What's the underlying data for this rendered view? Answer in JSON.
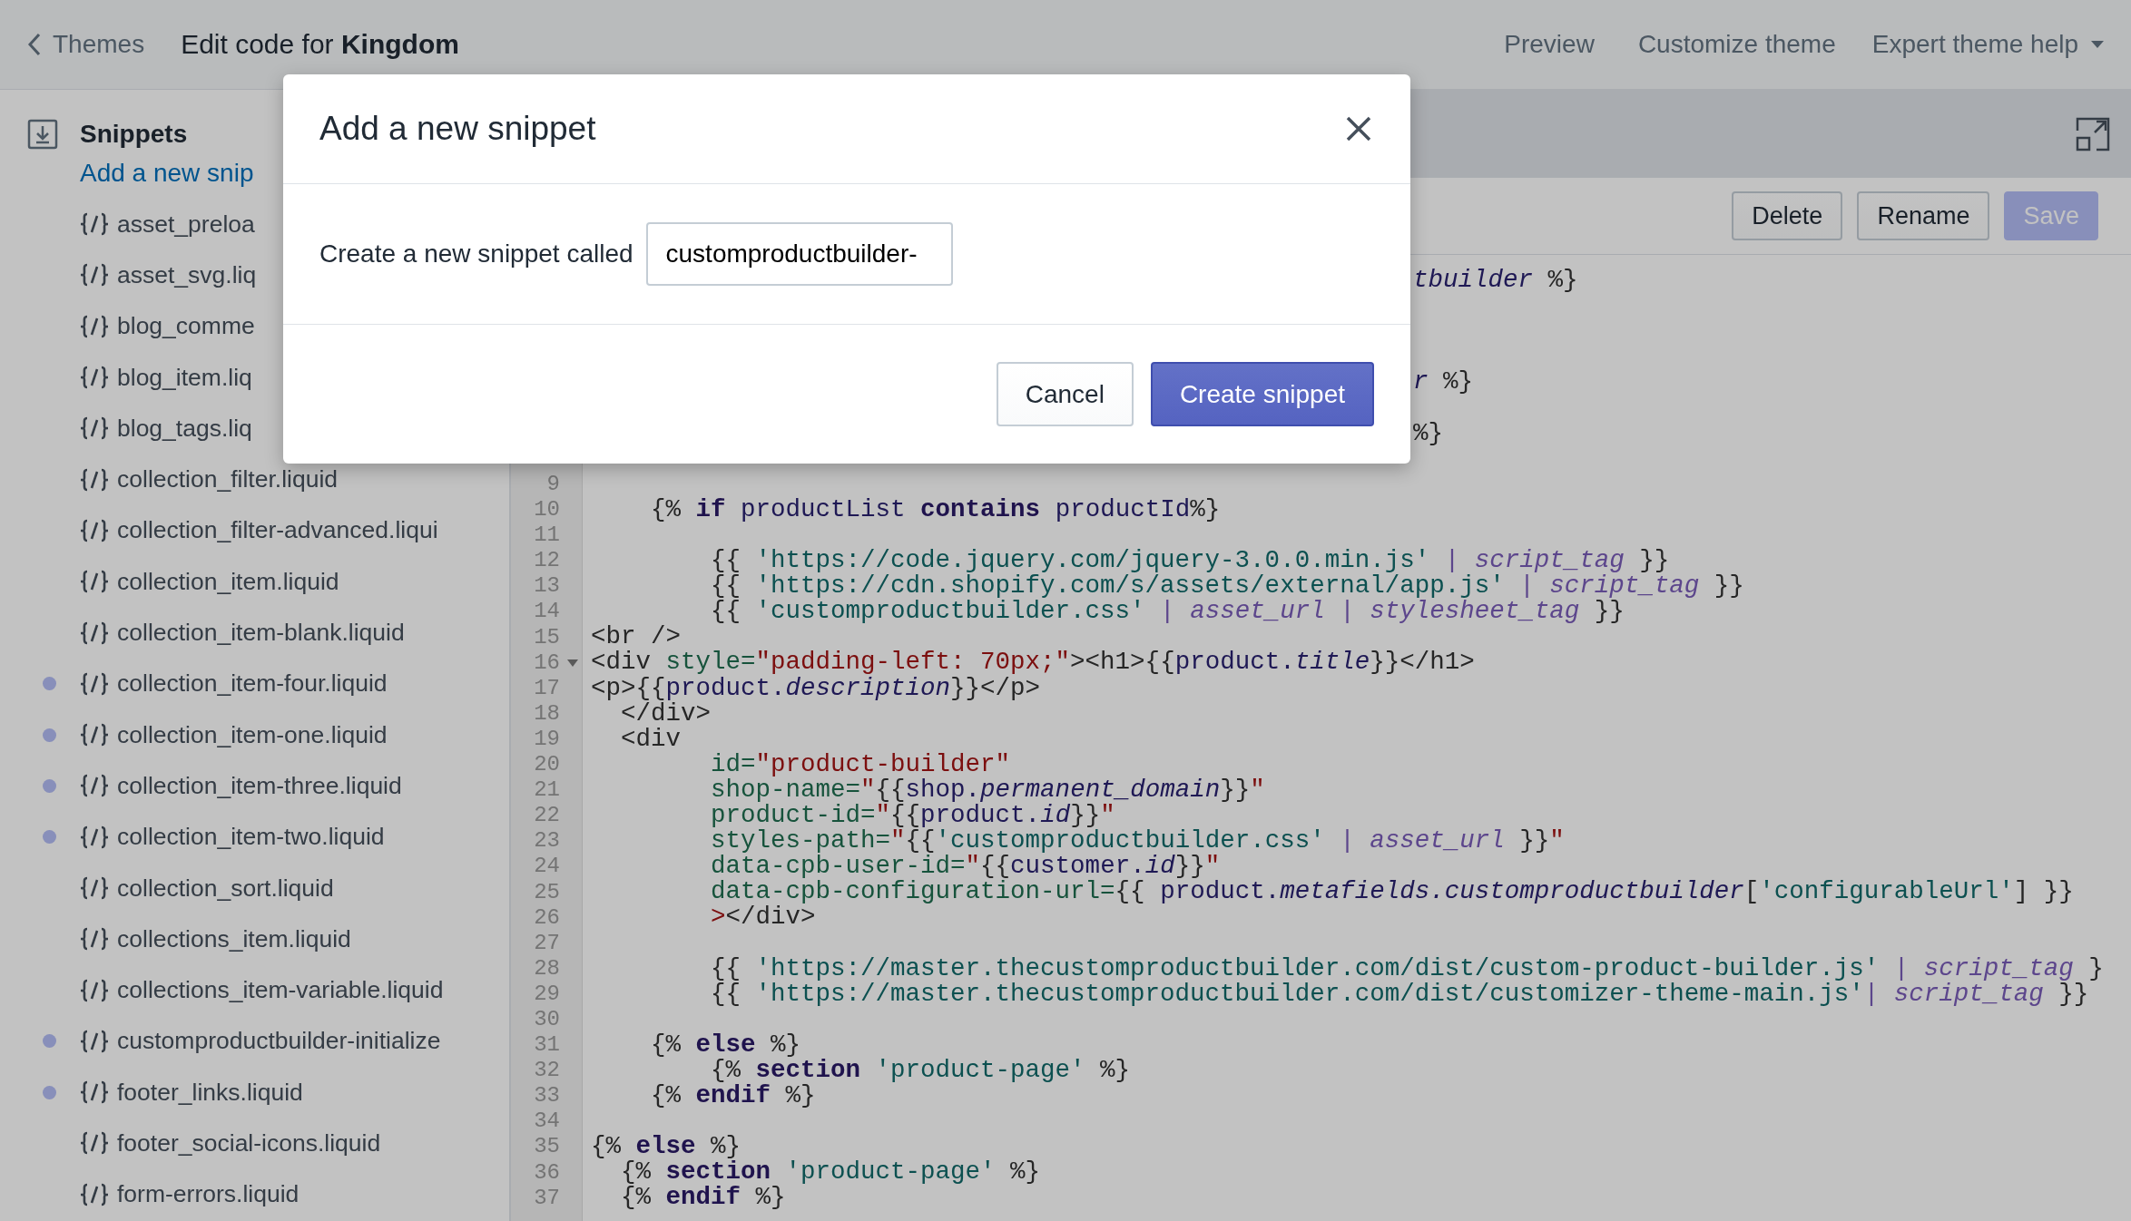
{
  "topbar": {
    "back_link": "Themes",
    "title": "Edit code for **Kingdom**",
    "links": [
      "Preview",
      "Customize theme"
    ],
    "menu": "Expert theme help"
  },
  "sidebar": {
    "heading": "Snippets",
    "add_link": "Add a new snip",
    "items": [
      {
        "name": "asset_preloa",
        "changed": false
      },
      {
        "name": "asset_svg.liq",
        "changed": false
      },
      {
        "name": "blog_comme",
        "changed": false
      },
      {
        "name": "blog_item.liq",
        "changed": false
      },
      {
        "name": "blog_tags.liq",
        "changed": false
      },
      {
        "name": "collection_filter.liquid",
        "changed": false
      },
      {
        "name": "collection_filter-advanced.liqui",
        "changed": false
      },
      {
        "name": "collection_item.liquid",
        "changed": false
      },
      {
        "name": "collection_item-blank.liquid",
        "changed": false
      },
      {
        "name": "collection_item-four.liquid",
        "changed": true
      },
      {
        "name": "collection_item-one.liquid",
        "changed": true
      },
      {
        "name": "collection_item-three.liquid",
        "changed": true
      },
      {
        "name": "collection_item-two.liquid",
        "changed": true
      },
      {
        "name": "collection_sort.liquid",
        "changed": false
      },
      {
        "name": "collections_item.liquid",
        "changed": false
      },
      {
        "name": "collections_item-variable.liquid",
        "changed": false
      },
      {
        "name": "customproductbuilder-initialize",
        "changed": true
      },
      {
        "name": "footer_links.liquid",
        "changed": true
      },
      {
        "name": "footer_social-icons.liquid",
        "changed": false
      },
      {
        "name": "form-errors.liquid",
        "changed": false
      }
    ]
  },
  "toolbar": {
    "buttons": [
      {
        "label": "Delete",
        "disabled": false
      },
      {
        "label": "Rename",
        "disabled": false
      },
      {
        "label": "Save",
        "disabled": true
      }
    ]
  },
  "covered_lines": [
    {
      "tokens": [
        {
          "text": "tbuilder",
          "kind": "i"
        },
        {
          "text": " %}",
          "kind": "p"
        }
      ]
    },
    {
      "tokens": [
        {
          "text": "r",
          "kind": "i"
        },
        {
          "text": " %}",
          "kind": "p"
        }
      ]
    },
    {
      "tokens": [
        {
          "text": "%}",
          "kind": "p"
        }
      ]
    }
  ],
  "lines": [
    {
      "number": "9",
      "foldable": false
    },
    {
      "number": "10",
      "foldable": false,
      "tokens": [
        {
          "text": "    {% ",
          "kind": "p"
        },
        {
          "text": "if",
          "kind": "k"
        },
        {
          "text": " productList ",
          "kind": "o"
        },
        {
          "text": "contains",
          "kind": "k"
        },
        {
          "text": " productId",
          "kind": "o"
        },
        {
          "text": "%}",
          "kind": "p"
        }
      ]
    },
    {
      "number": "11",
      "foldable": false
    },
    {
      "number": "12",
      "foldable": false,
      "tokens": [
        {
          "text": "        {{ ",
          "kind": "p"
        },
        {
          "text": "'https://code.jquery.com/jquery-3.0.0.min.js'",
          "kind": "s"
        },
        {
          "text": " | ",
          "kind": "b"
        },
        {
          "text": "script_tag",
          "kind": "f"
        },
        {
          "text": " }}",
          "kind": "p"
        }
      ]
    },
    {
      "number": "13",
      "foldable": false,
      "tokens": [
        {
          "text": "        {{ ",
          "kind": "p"
        },
        {
          "text": "'https://cdn.shopify.com/s/assets/external/app.js'",
          "kind": "s"
        },
        {
          "text": " | ",
          "kind": "b"
        },
        {
          "text": "script_tag",
          "kind": "f"
        },
        {
          "text": " }}",
          "kind": "p"
        }
      ]
    },
    {
      "number": "14",
      "foldable": false,
      "tokens": [
        {
          "text": "        {{ ",
          "kind": "p"
        },
        {
          "text": "'customproductbuilder.css'",
          "kind": "s"
        },
        {
          "text": " | ",
          "kind": "b"
        },
        {
          "text": "asset_url",
          "kind": "f"
        },
        {
          "text": " | ",
          "kind": "b"
        },
        {
          "text": "stylesheet_tag",
          "kind": "f"
        },
        {
          "text": " }}",
          "kind": "p"
        }
      ]
    },
    {
      "number": "15",
      "foldable": false,
      "tokens": [
        {
          "text": "<br />",
          "kind": "p"
        }
      ]
    },
    {
      "number": "16",
      "foldable": true,
      "tokens": [
        {
          "text": "<div ",
          "kind": "p"
        },
        {
          "text": "style=",
          "kind": "a"
        },
        {
          "text": "\"padding-left: 70px;\"",
          "kind": "v"
        },
        {
          "text": "><h1>{{",
          "kind": "p"
        },
        {
          "text": "product.",
          "kind": "o"
        },
        {
          "text": "title",
          "kind": "i"
        },
        {
          "text": "}}</h1>",
          "kind": "p"
        }
      ]
    },
    {
      "number": "17",
      "foldable": false,
      "tokens": [
        {
          "text": "<p>{{",
          "kind": "p"
        },
        {
          "text": "product.",
          "kind": "o"
        },
        {
          "text": "description",
          "kind": "i"
        },
        {
          "text": "}}</p>",
          "kind": "p"
        }
      ]
    },
    {
      "number": "18",
      "foldable": false,
      "tokens": [
        {
          "text": "  </div>",
          "kind": "p"
        }
      ]
    },
    {
      "number": "19",
      "foldable": false,
      "tokens": [
        {
          "text": "  <div",
          "kind": "p"
        }
      ]
    },
    {
      "number": "20",
      "foldable": false,
      "tokens": [
        {
          "text": "        id=",
          "kind": "a"
        },
        {
          "text": "\"product-builder\"",
          "kind": "v"
        }
      ]
    },
    {
      "number": "21",
      "foldable": false,
      "tokens": [
        {
          "text": "        shop-name=",
          "kind": "a"
        },
        {
          "text": "\"",
          "kind": "v"
        },
        {
          "text": "{{",
          "kind": "p"
        },
        {
          "text": "shop.",
          "kind": "o"
        },
        {
          "text": "permanent_domain",
          "kind": "i"
        },
        {
          "text": "}}",
          "kind": "p"
        },
        {
          "text": "\"",
          "kind": "v"
        }
      ]
    },
    {
      "number": "22",
      "foldable": false,
      "tokens": [
        {
          "text": "        product-id=",
          "kind": "a"
        },
        {
          "text": "\"",
          "kind": "v"
        },
        {
          "text": "{{",
          "kind": "p"
        },
        {
          "text": "product.",
          "kind": "o"
        },
        {
          "text": "id",
          "kind": "i"
        },
        {
          "text": "}}",
          "kind": "p"
        },
        {
          "text": "\"",
          "kind": "v"
        }
      ]
    },
    {
      "number": "23",
      "foldable": false,
      "tokens": [
        {
          "text": "        styles-path=",
          "kind": "a"
        },
        {
          "text": "\"",
          "kind": "v"
        },
        {
          "text": "{{",
          "kind": "p"
        },
        {
          "text": "'customproductbuilder.css'",
          "kind": "s"
        },
        {
          "text": " | ",
          "kind": "b"
        },
        {
          "text": "asset_url",
          "kind": "f"
        },
        {
          "text": " }}",
          "kind": "p"
        },
        {
          "text": "\"",
          "kind": "v"
        }
      ]
    },
    {
      "number": "24",
      "foldable": false,
      "tokens": [
        {
          "text": "        data-cpb-user-id=",
          "kind": "a"
        },
        {
          "text": "\"",
          "kind": "v"
        },
        {
          "text": "{{",
          "kind": "p"
        },
        {
          "text": "customer.",
          "kind": "o"
        },
        {
          "text": "id",
          "kind": "i"
        },
        {
          "text": "}}",
          "kind": "p"
        },
        {
          "text": "\"",
          "kind": "v"
        }
      ]
    },
    {
      "number": "25",
      "foldable": false,
      "tokens": [
        {
          "text": "        data-cpb-configuration-url=",
          "kind": "a"
        },
        {
          "text": "{{ ",
          "kind": "p"
        },
        {
          "text": "product.",
          "kind": "o"
        },
        {
          "text": "metafields.customproductbuilder",
          "kind": "i"
        },
        {
          "text": "[",
          "kind": "p"
        },
        {
          "text": "'configurableUrl'",
          "kind": "s"
        },
        {
          "text": "] }}",
          "kind": "p"
        }
      ]
    },
    {
      "number": "26",
      "foldable": false,
      "tokens": [
        {
          "text": "        >",
          "kind": "v"
        },
        {
          "text": "</div>",
          "kind": "p"
        }
      ]
    },
    {
      "number": "27",
      "foldable": false
    },
    {
      "number": "28",
      "foldable": false,
      "tokens": [
        {
          "text": "        {{ ",
          "kind": "p"
        },
        {
          "text": "'https://master.thecustomproductbuilder.com/dist/custom-product-builder.js'",
          "kind": "s"
        },
        {
          "text": " | ",
          "kind": "b"
        },
        {
          "text": "script_tag",
          "kind": "f"
        },
        {
          "text": " }",
          "kind": "p"
        }
      ]
    },
    {
      "number": "29",
      "foldable": false,
      "tokens": [
        {
          "text": "        {{ ",
          "kind": "p"
        },
        {
          "text": "'https://master.thecustomproductbuilder.com/dist/customizer-theme-main.js'",
          "kind": "s"
        },
        {
          "text": "| ",
          "kind": "b"
        },
        {
          "text": "script_tag",
          "kind": "f"
        },
        {
          "text": " }}",
          "kind": "p"
        }
      ]
    },
    {
      "number": "30",
      "foldable": false
    },
    {
      "number": "31",
      "foldable": false,
      "tokens": [
        {
          "text": "    {% ",
          "kind": "p"
        },
        {
          "text": "else",
          "kind": "k"
        },
        {
          "text": " %}",
          "kind": "p"
        }
      ]
    },
    {
      "number": "32",
      "foldable": false,
      "tokens": [
        {
          "text": "        {% ",
          "kind": "p"
        },
        {
          "text": "section",
          "kind": "k"
        },
        {
          "text": " 'product-page'",
          "kind": "s"
        },
        {
          "text": " %}",
          "kind": "p"
        }
      ]
    },
    {
      "number": "33",
      "foldable": false,
      "tokens": [
        {
          "text": "    {% ",
          "kind": "p"
        },
        {
          "text": "endif",
          "kind": "k"
        },
        {
          "text": " %}",
          "kind": "p"
        }
      ]
    },
    {
      "number": "34",
      "foldable": false
    },
    {
      "number": "35",
      "foldable": false,
      "tokens": [
        {
          "text": "{% ",
          "kind": "p"
        },
        {
          "text": "else",
          "kind": "k"
        },
        {
          "text": " %}",
          "kind": "p"
        }
      ]
    },
    {
      "number": "36",
      "foldable": false,
      "tokens": [
        {
          "text": "  {% ",
          "kind": "p"
        },
        {
          "text": "section",
          "kind": "k"
        },
        {
          "text": " 'product-page'",
          "kind": "s"
        },
        {
          "text": " %}",
          "kind": "p"
        }
      ]
    },
    {
      "number": "37",
      "foldable": false,
      "tokens": [
        {
          "text": "  {% ",
          "kind": "p"
        },
        {
          "text": "endif",
          "kind": "k"
        },
        {
          "text": " %}",
          "kind": "p"
        }
      ]
    }
  ],
  "modal": {
    "title": "Add a new snippet",
    "field_label": "Create a new snippet called",
    "field_value": "customproductbuilder-",
    "buttons": [
      {
        "label": "Cancel",
        "kind": "secondary"
      },
      {
        "label": "Create snippet",
        "kind": "primary"
      }
    ]
  }
}
